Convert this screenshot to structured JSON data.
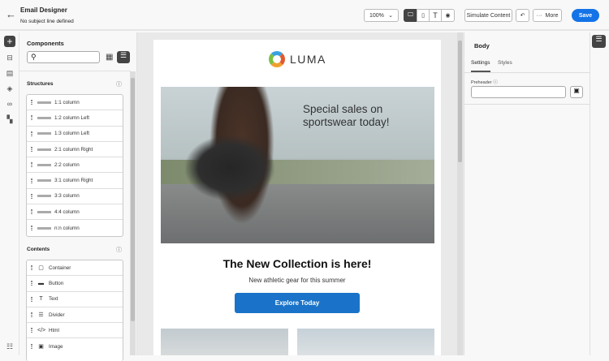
{
  "header": {
    "title": "Email Designer",
    "subtitle": "No subject line defined",
    "zoom": "100%",
    "simulate": "Simulate Content",
    "more": "More",
    "save": "Save"
  },
  "components": {
    "title": "Components",
    "search_placeholder": "",
    "structures_title": "Structures",
    "structures": [
      "1:1 column",
      "1:2 column Left",
      "1:3 column Left",
      "2:1 column Right",
      "2:2 column",
      "3:1 column Right",
      "3:3 column",
      "4:4 column",
      "n:n column"
    ],
    "contents_title": "Contents",
    "contents": [
      {
        "label": "Container",
        "icon": "▢"
      },
      {
        "label": "Button",
        "icon": "▬"
      },
      {
        "label": "Text",
        "icon": "T"
      },
      {
        "label": "Divider",
        "icon": "☰"
      },
      {
        "label": "Html",
        "icon": "</>"
      },
      {
        "label": "Image",
        "icon": "▣"
      }
    ]
  },
  "email": {
    "logo": "LUMA",
    "hero_text": "Special sales on sportswear today!",
    "heading": "The New Collection is here!",
    "subheading": "New athletic gear for this summer",
    "cta": "Explore Today"
  },
  "panel": {
    "title": "Body",
    "tabs": [
      "Settings",
      "Styles"
    ],
    "preheader_label": "Preheader",
    "preheader_value": ""
  },
  "colors": {
    "accent": "#1473e6",
    "cta": "#1a73c8"
  }
}
